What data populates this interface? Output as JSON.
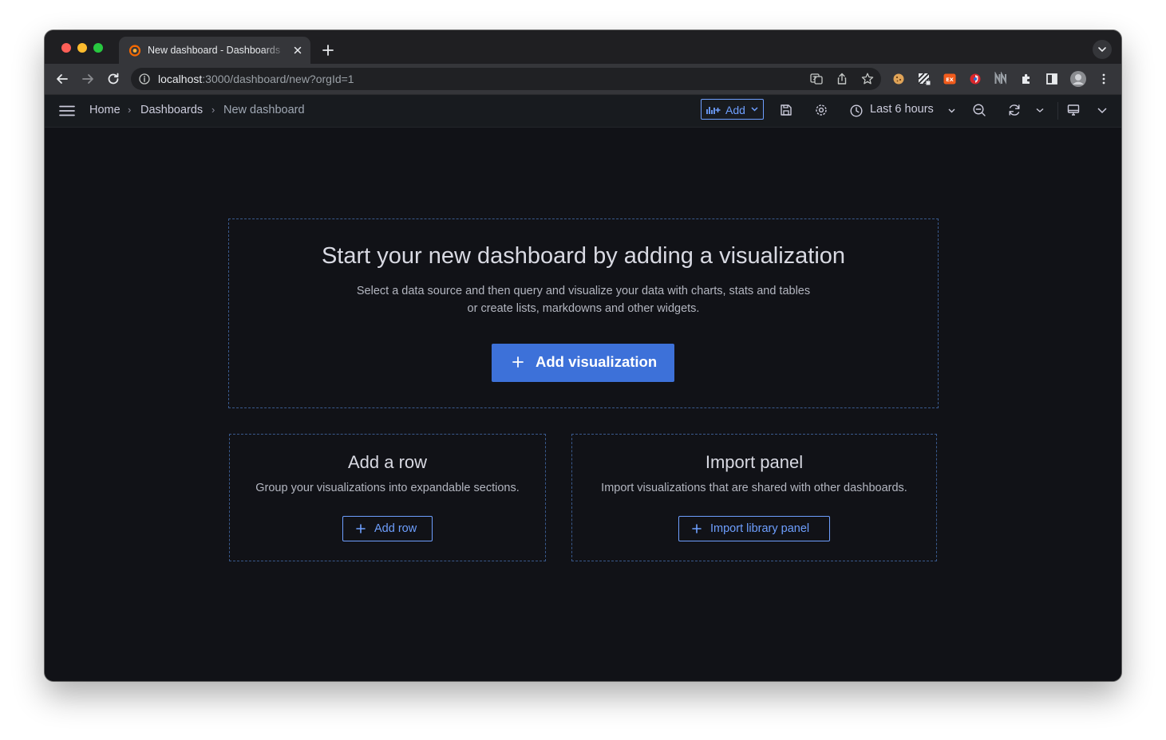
{
  "browser": {
    "tab": {
      "title": "New dashboard - Dashboards - Grafana"
    },
    "url": {
      "host": "localhost",
      "rest": ":3000/dashboard/new?orgId=1"
    }
  },
  "header": {
    "breadcrumbs": [
      "Home",
      "Dashboards",
      "New dashboard"
    ],
    "separator": "›",
    "add_label": "Add",
    "time_range_label": "Last 6 hours"
  },
  "main": {
    "hero": {
      "title": "Start your new dashboard by adding a visualization",
      "description_line1": "Select a data source and then query and visualize your data with charts, stats and tables",
      "description_line2": "or create lists, markdowns and other widgets.",
      "button_label": "Add visualization"
    },
    "row_card": {
      "title": "Add a row",
      "description": "Group your visualizations into expandable sections.",
      "button_label": "Add row"
    },
    "import_card": {
      "title": "Import panel",
      "description": "Import visualizations that are shared with other dashboards.",
      "button_label": "Import library panel"
    }
  },
  "colors": {
    "accent": "#3d71d9",
    "link_blue": "#6e9fff",
    "canvas": "#111217",
    "header": "#181b1f"
  }
}
